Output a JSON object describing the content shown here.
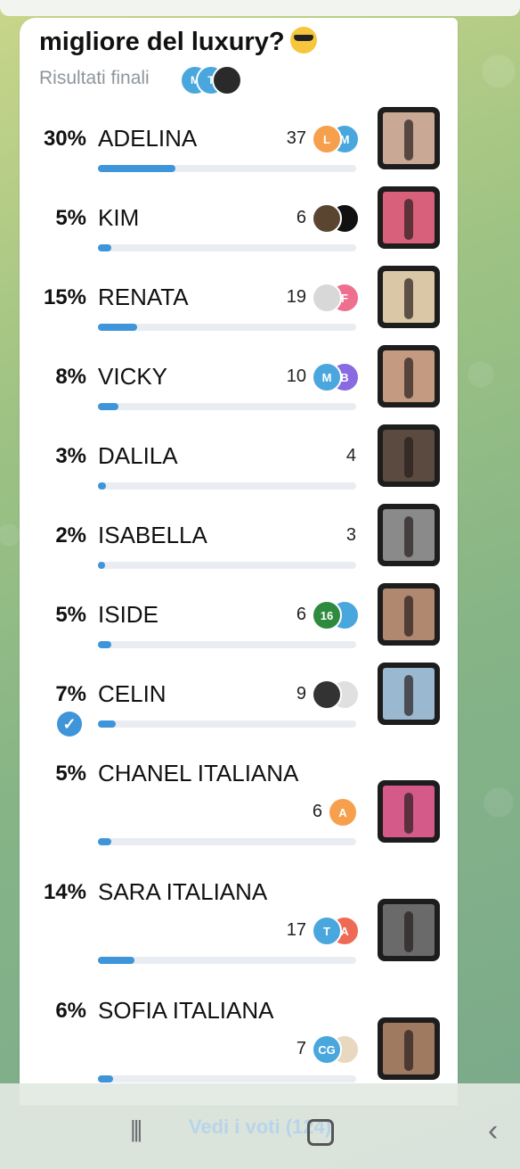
{
  "poll": {
    "title": "migliore del luxury?",
    "title_emoji": "sunglasses-emoji",
    "subtitle": "Risultati finali",
    "recent_voters": [
      "M",
      "T",
      ""
    ],
    "options": [
      {
        "percent": "30%",
        "name": "ADELINA",
        "votes": "37",
        "fill": 0.3,
        "avatars": [
          {
            "l": "L",
            "c": "#f6a04d"
          },
          {
            "l": "M",
            "c": "#4aa7de"
          }
        ],
        "thumb": "#c9a895"
      },
      {
        "percent": "5%",
        "name": "KIM",
        "votes": "6",
        "fill": 0.05,
        "avatars": [
          {
            "l": "",
            "c": "#5a4630"
          },
          {
            "l": "",
            "c": "#111111"
          }
        ],
        "thumb": "#d8607a"
      },
      {
        "percent": "15%",
        "name": "RENATA",
        "votes": "19",
        "fill": 0.15,
        "avatars": [
          {
            "l": "",
            "c": "#d8d8d8"
          },
          {
            "l": "F",
            "c": "#ef6f8f"
          }
        ],
        "thumb": "#d9c7a6"
      },
      {
        "percent": "8%",
        "name": "VICKY",
        "votes": "10",
        "fill": 0.08,
        "avatars": [
          {
            "l": "M",
            "c": "#4aa7de"
          },
          {
            "l": "B",
            "c": "#8a6ae0"
          }
        ],
        "thumb": "#c49a80"
      },
      {
        "percent": "3%",
        "name": "DALILA",
        "votes": "4",
        "fill": 0.03,
        "avatars": [],
        "thumb": "#5b4a40"
      },
      {
        "percent": "2%",
        "name": "ISABELLA",
        "votes": "3",
        "fill": 0.02,
        "avatars": [],
        "thumb": "#8a8a8a"
      },
      {
        "percent": "5%",
        "name": "ISIDE",
        "votes": "6",
        "fill": 0.05,
        "avatars": [
          {
            "l": "16",
            "c": "#2e8a3e"
          },
          {
            "l": "",
            "c": "#4aa7de"
          }
        ],
        "thumb": "#b08870"
      },
      {
        "percent": "7%",
        "name": "CELIN",
        "votes": "9",
        "fill": 0.07,
        "avatars": [
          {
            "l": "",
            "c": "#333333"
          },
          {
            "l": "",
            "c": "#e0e0e0"
          }
        ],
        "thumb": "#9ab8d0",
        "chosen": true
      },
      {
        "percent": "5%",
        "name": "CHANEL ITALIANA",
        "votes": "6",
        "fill": 0.05,
        "avatars": [
          {
            "l": "A",
            "c": "#f6a04d"
          }
        ],
        "thumb": "#d45a8a"
      },
      {
        "percent": "14%",
        "name": "SARA ITALIANA",
        "votes": "17",
        "fill": 0.14,
        "avatars": [
          {
            "l": "T",
            "c": "#4aa7de"
          },
          {
            "l": "A",
            "c": "#ef6a55"
          }
        ],
        "thumb": "#6a6a6a"
      },
      {
        "percent": "6%",
        "name": "SOFIA ITALIANA",
        "votes": "7",
        "fill": 0.06,
        "avatars": [
          {
            "l": "CG",
            "c": "#4aa7de"
          },
          {
            "l": "",
            "c": "#e8d8c0"
          }
        ],
        "thumb": "#a07a60"
      }
    ]
  },
  "footer": {
    "votes_button": "Vedi i voti (124)"
  },
  "system_nav": {
    "recent_icon": "recent-apps-icon",
    "home_icon": "home-icon",
    "back_icon": "back-icon"
  },
  "colors": {
    "accent": "#3e95da",
    "track": "#e9edf1",
    "bubble": "#ffffff"
  }
}
